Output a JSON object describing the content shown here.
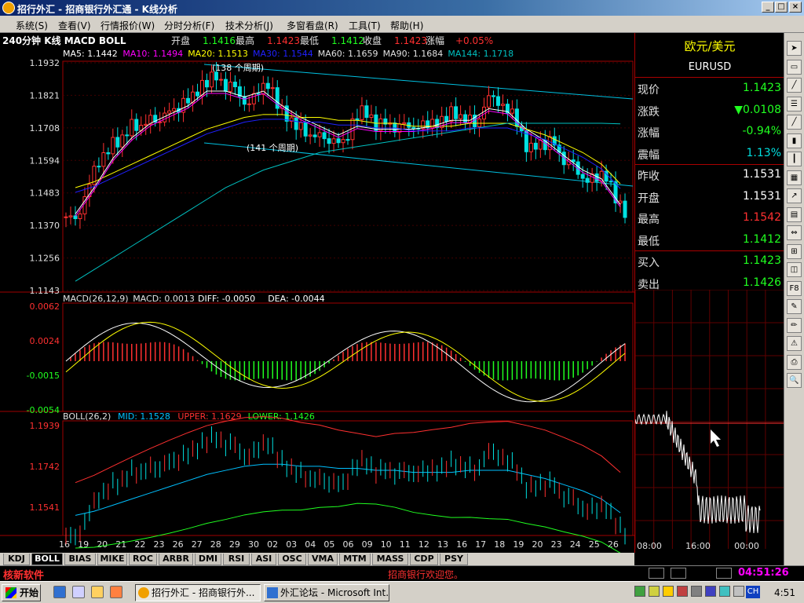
{
  "window": {
    "title": "招行外汇 - 招商银行外汇通 - K线分析"
  },
  "menu": [
    "系统(S)",
    "查看(V)",
    "行情报价(W)",
    "分时分析(F)",
    "技术分析(J)",
    "多窗看盘(R)",
    "工具(T)",
    "帮助(H)"
  ],
  "chart": {
    "header": {
      "title": "240分钟 K线 MACD BOLL",
      "open_label": "开盘",
      "open": "1.1416",
      "high_label": "最高",
      "high": "1.1423",
      "low_label": "最低",
      "low": "1.1412",
      "close_label": "收盘",
      "close": "1.1423",
      "change_label": "涨幅",
      "change": "+0.05%"
    },
    "ma_line": [
      {
        "text": "MA5: 1.1442",
        "color": "#ffffff"
      },
      {
        "text": "MA10: 1.1494",
        "color": "#ff00ff"
      },
      {
        "text": "MA20: 1.1513",
        "color": "#ffff00"
      },
      {
        "text": "MA30: 1.1544",
        "color": "#2020ff"
      },
      {
        "text": "MA60: 1.1659",
        "color": "#e0e0e0"
      },
      {
        "text": "MA90: 1.1684",
        "color": "#e0e0e0"
      },
      {
        "text": "MA144: 1.1718",
        "color": "#00c0c0"
      }
    ],
    "price_ticks": [
      "1.1932",
      "1.1821",
      "1.1708",
      "1.1594",
      "1.1483",
      "1.1370",
      "1.1256",
      "1.1143"
    ],
    "annotations": [
      "(138 个周期)",
      "(141 个周期)"
    ],
    "macd": {
      "header": [
        {
          "text": "MACD(26,12,9)",
          "color": "#e0e0e0"
        },
        {
          "text": "MACD: 0.0013",
          "color": "#e0e0e0"
        },
        {
          "text": "DIFF: -0.0050",
          "color": "#ffffff"
        },
        {
          "text": "DEA: -0.0044",
          "color": "#ffffff"
        }
      ],
      "ticks": [
        "0.0062",
        "0.0024",
        "-0.0015",
        "-0.0054"
      ]
    },
    "boll": {
      "header": [
        {
          "text": "BOLL(26,2)",
          "color": "#e0e0e0"
        },
        {
          "text": "MID: 1.1528",
          "color": "#00c0ff"
        },
        {
          "text": "UPPER: 1.1629",
          "color": "#ff3030"
        },
        {
          "text": "LOWER: 1.1426",
          "color": "#20ff20"
        }
      ],
      "ticks": [
        "1.1939",
        "1.1742",
        "1.1541"
      ]
    },
    "date_labels": [
      "16",
      "19",
      "20",
      "21",
      "22",
      "23",
      "26",
      "27",
      "28",
      "29",
      "30",
      "02",
      "03",
      "04",
      "05",
      "06",
      "09",
      "10",
      "11",
      "12",
      "13",
      "16",
      "17",
      "18",
      "19",
      "20",
      "23",
      "24",
      "25",
      "26"
    ],
    "colors": {
      "up": "#ff3030",
      "down": "#00e0e0",
      "grid": "#a00000"
    }
  },
  "chart_data": {
    "type": "candlestick",
    "title": "240分钟 K线 MACD BOLL",
    "x": [
      "16",
      "19",
      "20",
      "21",
      "22",
      "23",
      "26",
      "27",
      "28",
      "29",
      "30",
      "02",
      "03",
      "04",
      "05",
      "06",
      "09",
      "10",
      "11",
      "12",
      "13",
      "16",
      "17",
      "18",
      "19",
      "20",
      "23",
      "24",
      "25",
      "26"
    ],
    "ylim": [
      1.1143,
      1.1932
    ],
    "series": [
      {
        "name": "close",
        "values": [
          1.14,
          1.158,
          1.166,
          1.172,
          1.174,
          1.177,
          1.181,
          1.187,
          1.184,
          1.178,
          1.185,
          1.175,
          1.17,
          1.168,
          1.166,
          1.176,
          1.171,
          1.17,
          1.17,
          1.172,
          1.176,
          1.173,
          1.182,
          1.176,
          1.163,
          1.165,
          1.158,
          1.152,
          1.154,
          1.1423
        ]
      },
      {
        "name": "MA5",
        "values": [
          1.141,
          1.15,
          1.16,
          1.167,
          1.172,
          1.175,
          1.178,
          1.183,
          1.183,
          1.181,
          1.183,
          1.178,
          1.174,
          1.171,
          1.168,
          1.171,
          1.17,
          1.17,
          1.17,
          1.171,
          1.173,
          1.173,
          1.177,
          1.176,
          1.17,
          1.166,
          1.161,
          1.156,
          1.153,
          1.1442
        ]
      },
      {
        "name": "MA20",
        "values": [
          1.15,
          1.152,
          1.155,
          1.158,
          1.161,
          1.164,
          1.167,
          1.17,
          1.172,
          1.174,
          1.175,
          1.175,
          1.174,
          1.174,
          1.173,
          1.173,
          1.172,
          1.172,
          1.171,
          1.171,
          1.171,
          1.172,
          1.172,
          1.172,
          1.17,
          1.168,
          1.165,
          1.162,
          1.158,
          1.1513
        ]
      },
      {
        "name": "MA144",
        "values": [
          1.118,
          1.122,
          1.126,
          1.13,
          1.134,
          1.138,
          1.142,
          1.146,
          1.15,
          1.153,
          1.156,
          1.158,
          1.16,
          1.162,
          1.163,
          1.164,
          1.165,
          1.166,
          1.167,
          1.168,
          1.169,
          1.17,
          1.171,
          1.172,
          1.172,
          1.172,
          1.172,
          1.172,
          1.172,
          1.1718
        ]
      }
    ]
  },
  "quote": {
    "pair_cn": "欧元/美元",
    "pair_code": "EURUSD",
    "rows": [
      {
        "label": "现价",
        "value": "1.1423",
        "color": "#20ff20"
      },
      {
        "label": "涨跌",
        "value": "▼0.0108",
        "color": "#20ff20"
      },
      {
        "label": "涨幅",
        "value": "-0.94%",
        "color": "#20ff20"
      },
      {
        "label": "震幅",
        "value": "1.13%",
        "color": "#00e0e0"
      },
      {
        "label": "昨收",
        "value": "1.1531",
        "color": "#ffffff"
      },
      {
        "label": "开盘",
        "value": "1.1531",
        "color": "#ffffff"
      },
      {
        "label": "最高",
        "value": "1.1542",
        "color": "#ff3030"
      },
      {
        "label": "最低",
        "value": "1.1412",
        "color": "#20ff20"
      },
      {
        "label": "买入",
        "value": "1.1423",
        "color": "#20ff20"
      },
      {
        "label": "卖出",
        "value": "1.1426",
        "color": "#20ff20"
      }
    ],
    "time_labels": [
      "08:00",
      "16:00",
      "00:00"
    ]
  },
  "tabs": [
    "KDJ",
    "BOLL",
    "BIAS",
    "MIKE",
    "ROC",
    "ARBR",
    "DMI",
    "RSI",
    "ASI",
    "OSC",
    "VMA",
    "MTM",
    "MASS",
    "CDP",
    "PSY"
  ],
  "active_tab": "BOLL",
  "status": {
    "brand": "核新软件",
    "welcome": "招商银行欢迎您。",
    "clock": "04:51:26"
  },
  "taskbar": {
    "start": "开始",
    "tasks": [
      "招行外汇 - 招商银行外...",
      "外汇论坛 - Microsoft Int..."
    ],
    "tray_ch": "CH",
    "time": "4:51"
  }
}
